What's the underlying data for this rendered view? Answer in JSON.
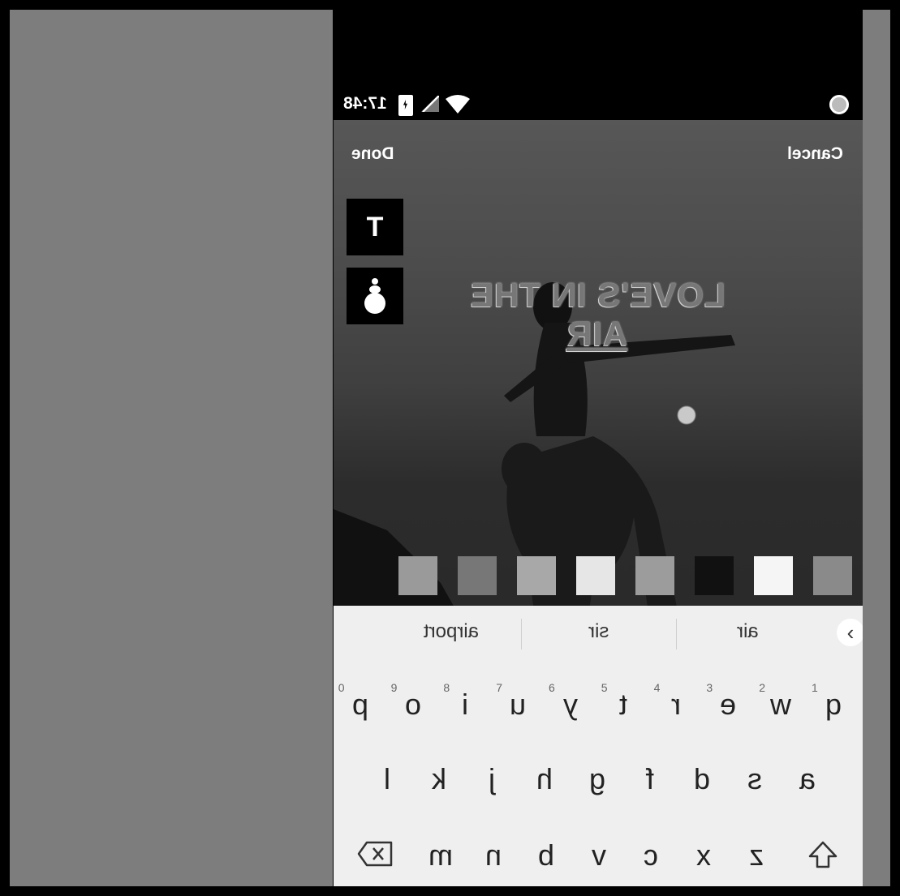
{
  "status": {
    "time": "17:48",
    "icons": [
      "battery-charging-icon",
      "no-signal-icon",
      "wifi-icon",
      "screen-record-icon"
    ]
  },
  "editor": {
    "done_label": "Done",
    "cancel_label": "Cancel",
    "tools": {
      "text_tool_label": "T",
      "style_tool_icon": "text-style-icon"
    },
    "caption": {
      "line1": "LOVE'S IN THE",
      "line2": "AIR"
    },
    "swatch_colors": [
      "#8a8a8a",
      "#f5f5f5",
      "#111111",
      "#9c9c9c",
      "#e6e6e6",
      "#a8a8a8",
      "#777777",
      "#9a9a9a"
    ]
  },
  "keyboard": {
    "suggestions": [
      "air",
      "sir",
      "airport"
    ],
    "row1": [
      "q",
      "w",
      "e",
      "r",
      "t",
      "y",
      "u",
      "i",
      "o",
      "p"
    ],
    "row1_numbers": [
      "1",
      "2",
      "3",
      "4",
      "5",
      "6",
      "7",
      "8",
      "9",
      "0"
    ],
    "row2": [
      "a",
      "s",
      "d",
      "f",
      "g",
      "h",
      "j",
      "k",
      "l"
    ],
    "row3": [
      "z",
      "x",
      "c",
      "v",
      "b",
      "n",
      "m"
    ],
    "shift_icon": "shift-icon",
    "backspace_icon": "backspace-icon"
  }
}
